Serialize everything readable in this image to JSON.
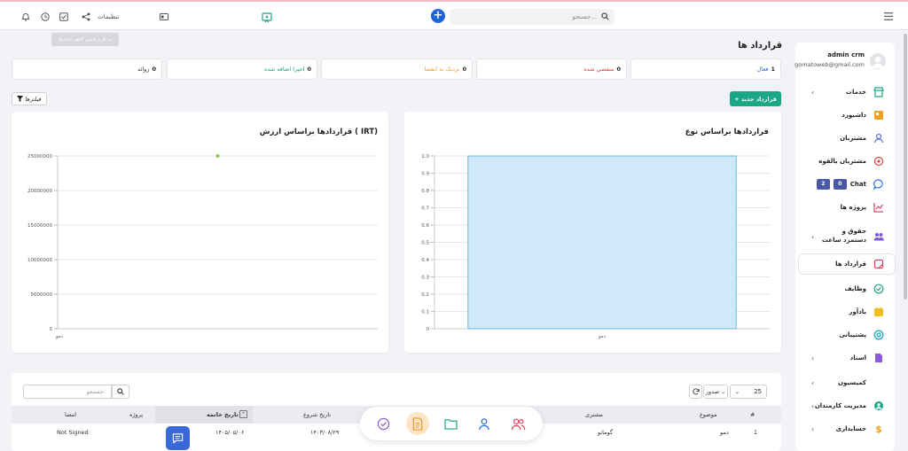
{
  "topbar": {
    "search_placeholder": "جستجو...",
    "settings_label": "تنظیمات",
    "tooltip_text": "به کاربر ادمین آگاهی داده ها"
  },
  "sidebar": {
    "user_name": "admin crm",
    "user_email": "gomatoweb@gmail.com",
    "items": [
      {
        "label": "خدمات",
        "icon": "store-icon",
        "color": "#1aa786",
        "chevron": true
      },
      {
        "label": "داشبورد",
        "icon": "dashboard-icon",
        "color": "#f0a020",
        "chevron": false
      },
      {
        "label": "مشتریان",
        "icon": "user-icon",
        "color": "#5a6fd8",
        "chevron": false
      },
      {
        "label": "مشتریان بالقوه",
        "icon": "target-icon",
        "color": "#e04040",
        "chevron": false
      },
      {
        "label": "Chat",
        "icon": "chat-icon",
        "color": "#2a7be0",
        "chevron": false,
        "badges": [
          "2",
          "0"
        ]
      },
      {
        "label": "پروژه ها",
        "icon": "chart-icon",
        "color": "#e0406a",
        "chevron": false
      },
      {
        "label": "حقوق و دستمزد ساعت",
        "icon": "team-icon",
        "color": "#7a5ad8",
        "chevron": true
      },
      {
        "label": "قرارداد ها",
        "icon": "contract-icon",
        "color": "#e04060",
        "chevron": false,
        "active": true
      },
      {
        "label": "وظایف",
        "icon": "check-circle-icon",
        "color": "#1aa786",
        "chevron": false
      },
      {
        "label": "یادآور",
        "icon": "reminder-icon",
        "color": "#f0c020",
        "chevron": false
      },
      {
        "label": "پشتیبانی",
        "icon": "support-icon",
        "color": "#1aa7c0",
        "chevron": false
      },
      {
        "label": "اسناد",
        "icon": "document-icon",
        "color": "#8a5ad8",
        "chevron": true
      },
      {
        "label": "کمیسیون",
        "icon": "commission-icon",
        "color": "#888888",
        "chevron": true
      },
      {
        "label": "مدیریت کارمندان",
        "icon": "employees-icon",
        "color": "#1aa786",
        "chevron": true
      },
      {
        "label": "حسابداری",
        "icon": "dollar-icon",
        "color": "#f0a020",
        "chevron": true
      }
    ]
  },
  "page": {
    "title": "قرارداد ها",
    "new_button": "+ قرارداد جدید",
    "filters_button": "فیلترها"
  },
  "stats": [
    {
      "count": "1",
      "label": "فعال",
      "color": "#2a6fd8"
    },
    {
      "count": "0",
      "label": "منقضی شده",
      "color": "#e04040"
    },
    {
      "count": "0",
      "label": "نزدیک به انقضا",
      "color": "#f0a020"
    },
    {
      "count": "0",
      "label": "اخیرا اضافه شده",
      "color": "#1aa786"
    },
    {
      "count": "0",
      "label": "زوائد",
      "color": "#333333"
    }
  ],
  "chart_data": [
    {
      "type": "bar",
      "title": "قراردادها براساس نوع",
      "categories": [
        "دمو"
      ],
      "values": [
        1.0
      ],
      "ylim": [
        0,
        1.0
      ],
      "yticks": [
        "1.0",
        "0.9",
        "0.8",
        "0.7",
        "0.6",
        "0.5",
        "0.4",
        "0.3",
        "0.2",
        "0.1",
        "0"
      ],
      "colors": {
        "fill": "#cfe9fb",
        "stroke": "#6cb4e0"
      },
      "grid": true
    },
    {
      "type": "scatter",
      "title": "قراردادها براساس ارزش ( IRT)",
      "categories": [
        "دمو"
      ],
      "values": [
        25000000
      ],
      "ylim": [
        0,
        25000000
      ],
      "yticks": [
        "25000000",
        "20000000",
        "15000000",
        "10000000",
        "5000000",
        "0"
      ],
      "colors": {
        "point": "#8cc84b"
      },
      "grid": true
    }
  ],
  "table": {
    "page_size": "25",
    "export_label": "صدور",
    "search_placeholder": "جستجو:",
    "columns": [
      "#",
      "موضوع",
      "مشتری",
      "تاریخ شروع",
      "تاریخ خاتمه",
      "پروژه",
      "امضا"
    ],
    "rows": [
      {
        "num": "1",
        "subject": "دمو",
        "customer": "گوماتو",
        "start": "۱۴۰۳/۰۸/۲۹",
        "end": "۱۴۰۵/۰۵/۰۶",
        "project": "",
        "signature": "Not Signed"
      }
    ]
  }
}
